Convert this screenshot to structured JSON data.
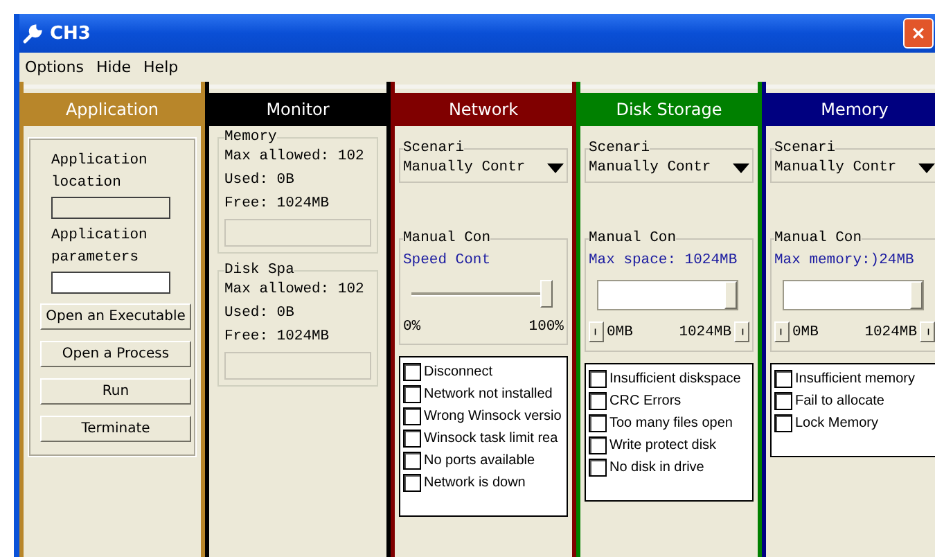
{
  "window": {
    "title": "CH3"
  },
  "menu": [
    "Options",
    "Hide",
    "Help"
  ],
  "panels": [
    {
      "kind": "application",
      "title": "Application",
      "color": "#b8862a",
      "location_label": "Application location",
      "parameters_label": "Application parameters",
      "buttons": [
        "Open an Executable",
        "Open a Process",
        "Run",
        "Terminate"
      ]
    },
    {
      "kind": "monitor",
      "title": "Monitor",
      "color": "#000000",
      "groups": [
        {
          "title": "Memory",
          "lines": [
            "Max allowed: 102",
            "Used: 0B",
            "Free: 1024MB"
          ]
        },
        {
          "title": "Disk Spa",
          "lines": [
            "Max allowed: 102",
            "Used: 0B",
            "Free: 1024MB"
          ]
        }
      ]
    },
    {
      "kind": "scenario",
      "title": "Network",
      "color": "#800000",
      "scenario_label": "Scenari",
      "scenario_value": "Manually Contr",
      "manual_label": "Manual Con",
      "slider": {
        "kind": "plain",
        "caption": "Speed Cont",
        "level": 1,
        "min": "0%",
        "max": "100%"
      },
      "checks": [
        {
          "label": "Disconnect",
          "checked": false
        },
        {
          "label": "Network not installed",
          "checked": false
        },
        {
          "label": "Wrong Winsock versio",
          "checked": false
        },
        {
          "label": "Winsock task limit rea",
          "checked": false
        },
        {
          "label": "No ports available",
          "checked": false
        },
        {
          "label": "Network is down",
          "checked": false
        }
      ]
    },
    {
      "kind": "scenario",
      "title": "Disk Storage",
      "color": "#008000",
      "scenario_label": "Scenari",
      "scenario_value": "Manually Contr",
      "manual_label": "Manual Con",
      "slider": {
        "kind": "field",
        "caption": "Max space: 1024MB",
        "level": 1,
        "min": "0MB",
        "max": "1024MB"
      },
      "checks": [
        {
          "label": "Insufficient diskspace",
          "checked": false
        },
        {
          "label": "CRC Errors",
          "checked": false
        },
        {
          "label": "Too many files open",
          "checked": false
        },
        {
          "label": "Write protect disk",
          "checked": false
        },
        {
          "label": "No disk in drive",
          "checked": false
        }
      ]
    },
    {
      "kind": "scenario",
      "title": "Memory",
      "color": "#000080",
      "scenario_label": "Scenari",
      "scenario_value": "Manually Contr",
      "manual_label": "Manual Con",
      "slider": {
        "kind": "field",
        "caption": "Max memory:)24MB",
        "level": 1,
        "min": "0MB",
        "max": "1024MB"
      },
      "checks": [
        {
          "label": "Insufficient memory",
          "checked": false
        },
        {
          "label": "Fail to allocate",
          "checked": false
        },
        {
          "label": "Lock Memory",
          "checked": false
        }
      ]
    }
  ]
}
